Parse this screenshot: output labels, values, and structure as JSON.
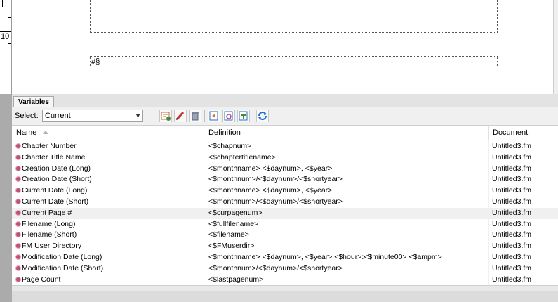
{
  "ruler": {
    "label": "10"
  },
  "document": {
    "frame_text": "#§"
  },
  "panel": {
    "tab_label": "Variables",
    "select_label": "Select:",
    "select_value": "Current",
    "toolbar_icons": [
      "new-variable-icon",
      "edit-variable-icon",
      "delete-variable-icon",
      "insert-variable-icon",
      "convert-to-text-icon",
      "update-icon",
      "refresh-icon"
    ]
  },
  "table": {
    "headers": {
      "name": "Name",
      "definition": "Definition",
      "document": "Document"
    },
    "rows": [
      {
        "name": "Chapter Number",
        "definition": "<$chapnum>",
        "document": "Untitled3.fm"
      },
      {
        "name": "Chapter Title Name",
        "definition": "<$chaptertitlename>",
        "document": "Untitled3.fm"
      },
      {
        "name": "Creation Date (Long)",
        "definition": "<$monthname> <$daynum>, <$year>",
        "document": "Untitled3.fm"
      },
      {
        "name": "Creation Date (Short)",
        "definition": "<$monthnum>/<$daynum>/<$shortyear>",
        "document": "Untitled3.fm"
      },
      {
        "name": "Current Date (Long)",
        "definition": "<$monthname> <$daynum>, <$year>",
        "document": "Untitled3.fm"
      },
      {
        "name": "Current Date (Short)",
        "definition": "<$monthnum>/<$daynum>/<$shortyear>",
        "document": "Untitled3.fm"
      },
      {
        "name": "Current Page #",
        "definition": "<$curpagenum>",
        "document": "Untitled3.fm"
      },
      {
        "name": "Filename (Long)",
        "definition": "<$fullfilename>",
        "document": "Untitled3.fm"
      },
      {
        "name": "Filename (Short)",
        "definition": "<$filename>",
        "document": "Untitled3.fm"
      },
      {
        "name": "FM User Directory",
        "definition": "<$FMuserdir>",
        "document": "Untitled3.fm"
      },
      {
        "name": "Modification Date (Long)",
        "definition": "<$monthname> <$daynum>, <$year> <$hour>:<$minute00> <$ampm>",
        "document": "Untitled3.fm"
      },
      {
        "name": "Modification Date (Short)",
        "definition": "<$monthnum>/<$daynum>/<$shortyear>",
        "document": "Untitled3.fm"
      },
      {
        "name": "Page Count",
        "definition": "<$lastpagenum>",
        "document": "Untitled3.fm"
      }
    ],
    "highlighted_row": "Current Page #"
  },
  "colors": {
    "variable_icon": "#c0507a",
    "refresh_icon": "#1e6fd6"
  }
}
